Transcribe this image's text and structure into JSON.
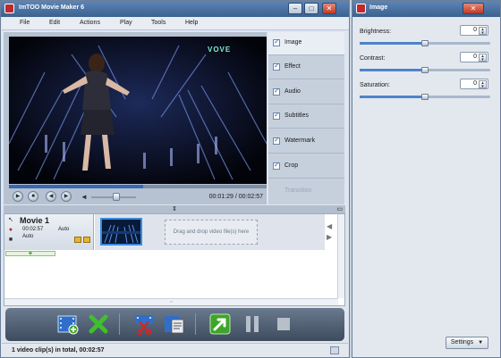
{
  "main_window": {
    "title": "ImTOO Movie Maker 6",
    "controls": {
      "minimize": "–",
      "maximize": "□",
      "close": "✕"
    }
  },
  "menu": [
    "File",
    "Edit",
    "Actions",
    "Play",
    "Tools",
    "Help"
  ],
  "video": {
    "overlay_logo": "VOVE",
    "progress_fraction": 0.52,
    "time_current": "00:01:29",
    "time_total": "00:02:57",
    "time_separator": "/",
    "volume_fraction": 0.55
  },
  "effects_panel": [
    {
      "label": "Image",
      "checked": true,
      "active": true
    },
    {
      "label": "Effect",
      "checked": true
    },
    {
      "label": "Audio",
      "checked": true
    },
    {
      "label": "Subtitles",
      "checked": true
    },
    {
      "label": "Watermark",
      "checked": true
    },
    {
      "label": "Crop",
      "checked": true
    },
    {
      "label": "Transition",
      "checked": false,
      "disabled": true
    }
  ],
  "timeline": {
    "movie_name": "Movie 1",
    "duration": "00:02:57",
    "auto_label_1": "Auto",
    "auto_label_2": "Auto",
    "drop_hint": "Drag and drop video file(s) here",
    "add_symbol": "+"
  },
  "status": {
    "text": "1 video clip(s) in total, 00:02:57"
  },
  "image_window": {
    "title": "Image",
    "close": "✕",
    "settings": [
      {
        "label": "Brightness:",
        "value": "0",
        "fraction": 0.5
      },
      {
        "label": "Contrast:",
        "value": "0",
        "fraction": 0.5
      },
      {
        "label": "Saturation:",
        "value": "0",
        "fraction": 0.5
      }
    ],
    "settings_button": "Settings",
    "settings_arrow": "▼"
  },
  "colors": {
    "titlebar": "#4a72a2",
    "accent": "#3a68b0",
    "toolbar": "#4e5d70",
    "add_green": "#2f8a1b"
  }
}
